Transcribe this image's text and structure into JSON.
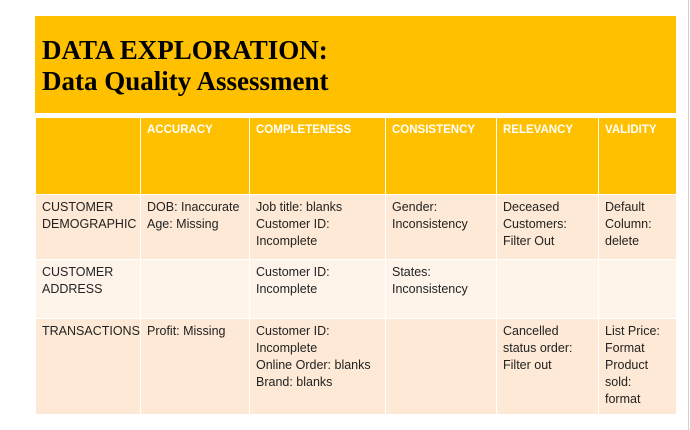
{
  "title": {
    "line1": "DATA EXPLORATION:",
    "line2": "Data Quality Assessment"
  },
  "table": {
    "headers": [
      "",
      "ACCURACY",
      "COMPLETENESS",
      "CONSISTENCY",
      "RELEVANCY",
      "VALIDITY"
    ],
    "rows": [
      {
        "cells": [
          [
            "CUSTOMER",
            "DEMOGRAPHIC"
          ],
          [
            "DOB: Inaccurate",
            "Age: Missing"
          ],
          [
            "Job title: blanks",
            "Customer ID:",
            "Incomplete"
          ],
          [
            "Gender:",
            "Inconsistency"
          ],
          [
            "Deceased",
            "Customers:",
            "Filter Out"
          ],
          [
            "Default",
            "Column:",
            "delete"
          ]
        ]
      },
      {
        "cells": [
          [
            "CUSTOMER",
            "ADDRESS"
          ],
          [],
          [
            "Customer ID:",
            "Incomplete"
          ],
          [
            "States:",
            "Inconsistency"
          ],
          [],
          []
        ]
      },
      {
        "cells": [
          [
            "TRANSACTIONS"
          ],
          [
            "Profit: Missing"
          ],
          [
            "Customer ID:",
            "Incomplete",
            "Online Order: blanks",
            "Brand: blanks"
          ],
          [],
          [
            "Cancelled",
            "status order:",
            "Filter out"
          ],
          [
            "List Price:",
            "Format",
            "Product",
            "sold:",
            "format"
          ]
        ]
      }
    ]
  },
  "colors": {
    "accent": "#ffc000",
    "row_dark": "#fde9d5",
    "row_light": "#fef4ea",
    "header_text": "#ffffff"
  }
}
